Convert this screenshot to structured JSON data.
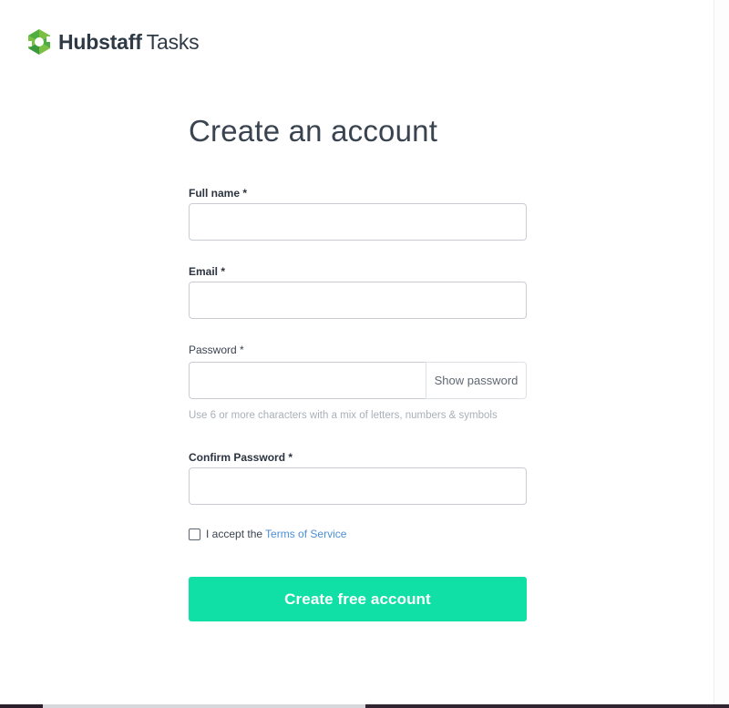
{
  "app": {
    "brand": "Hubstaff",
    "product": "Tasks",
    "logo_icon": "hubstaff-logo-icon",
    "logo_colors": [
      "#7ac143",
      "#3a9a3c"
    ]
  },
  "form": {
    "title": "Create an account",
    "full_name": {
      "label": "Full name *",
      "value": "",
      "placeholder": ""
    },
    "email": {
      "label": "Email *",
      "value": "",
      "placeholder": ""
    },
    "password": {
      "label": "Password *",
      "value": "",
      "placeholder": "",
      "show_label": "Show password",
      "hint": "Use 6 or more characters with a mix of letters, numbers & symbols"
    },
    "confirm_password": {
      "label": "Confirm Password *",
      "value": "",
      "placeholder": ""
    },
    "terms": {
      "checked": false,
      "text": "I accept the",
      "link": "Terms of Service"
    },
    "submit_label": "Create free account"
  },
  "colors": {
    "accent": "#10dfa6",
    "link": "#4a8fd6",
    "hint": "#a8b0b9",
    "input_border": "#c9cdd3"
  }
}
